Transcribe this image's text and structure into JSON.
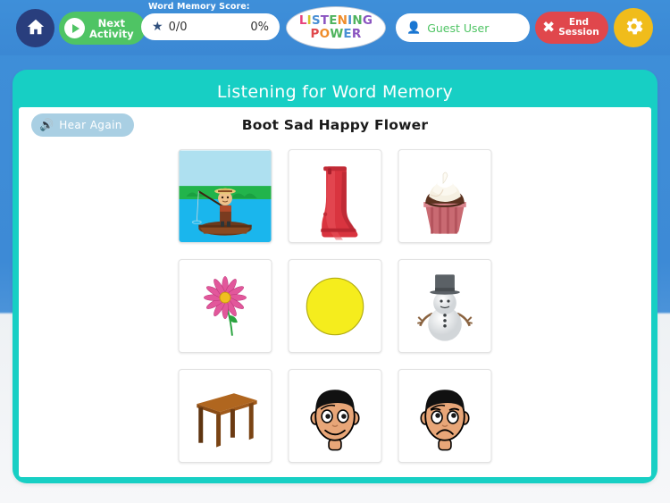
{
  "header": {
    "home_icon": "home-icon",
    "next_activity": {
      "label_line1": "Next",
      "label_line2": "Activity",
      "icon": "play-icon"
    },
    "score": {
      "label": "Word Memory Score:",
      "star_icon": "star-icon",
      "fraction": "0/0",
      "percent": "0%"
    },
    "logo": {
      "line1": "LISTENING",
      "line2": "POWER",
      "line1_letter_colors": [
        "#e8447e",
        "#d2c52a",
        "#4a8fd4",
        "#8a54c0",
        "#4fb35e",
        "#ef8c2a",
        "#4a8fd4",
        "#4fb35e",
        "#8a54c0"
      ],
      "line2_letter_colors": [
        "#e0484c",
        "#ef8c2a",
        "#4fb35e",
        "#4a8fd4",
        "#8a54c0"
      ]
    },
    "user": {
      "icon": "person-icon",
      "name": "Guest User"
    },
    "end_session": {
      "icon": "close-x-icon",
      "label_line1": "End",
      "label_line2": "Session"
    },
    "settings_icon": "gear-icon"
  },
  "panel": {
    "title": "Listening for Word Memory",
    "hear_again": {
      "icon": "speaker-icon",
      "label": "Hear Again"
    },
    "prompt": "Boot Sad Happy Flower"
  },
  "cards": [
    {
      "name": "fishing-boy-card",
      "alt": "boy fishing in a boat"
    },
    {
      "name": "boot-card",
      "alt": "red rain boot"
    },
    {
      "name": "cupcake-card",
      "alt": "chocolate cupcake with cream frosting"
    },
    {
      "name": "flower-card",
      "alt": "pink flower"
    },
    {
      "name": "yellow-circle-card",
      "alt": "yellow circle"
    },
    {
      "name": "snowman-card",
      "alt": "snowman with top hat"
    },
    {
      "name": "table-card",
      "alt": "wooden table"
    },
    {
      "name": "happy-face-card",
      "alt": "happy boy face"
    },
    {
      "name": "sad-face-card",
      "alt": "sad boy face"
    }
  ],
  "colors": {
    "background_blue": "#3e8fd9",
    "panel_teal": "#17cfc4",
    "green_button": "#4fc464",
    "red_button": "#e0474c",
    "gold_button": "#f0bc1b",
    "home_navy": "#293e7d",
    "hear_again_blue": "#a9cfe3"
  }
}
